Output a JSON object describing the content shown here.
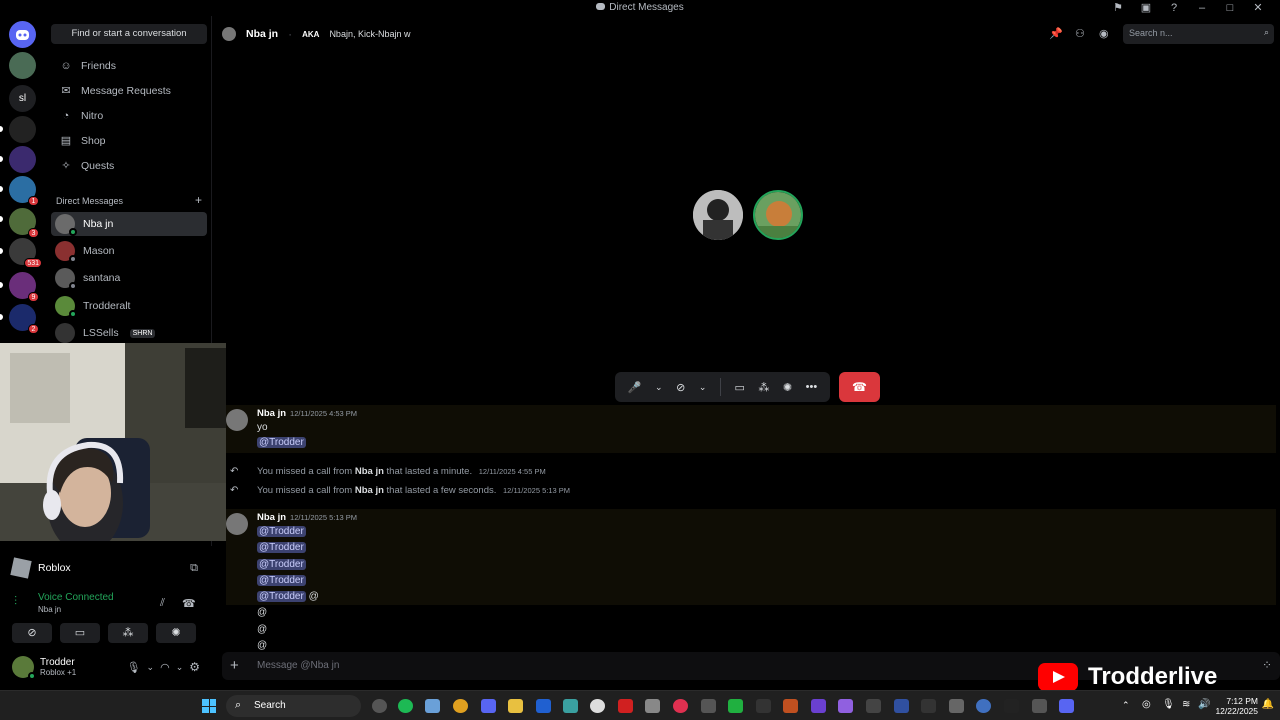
{
  "window": {
    "title": "Direct Messages"
  },
  "sidebar": {
    "find_label": "Find or start a conversation",
    "nav": [
      {
        "label": "Friends",
        "icon": "friends-icon"
      },
      {
        "label": "Message Requests",
        "icon": "mail-icon"
      },
      {
        "label": "Nitro",
        "icon": "nitro-icon"
      },
      {
        "label": "Shop",
        "icon": "shop-icon"
      },
      {
        "label": "Quests",
        "icon": "quests-icon"
      }
    ],
    "dm_header": "Direct Messages",
    "dm_add": "+",
    "dms": [
      {
        "name": "Nba jn",
        "active": true
      },
      {
        "name": "Mason"
      },
      {
        "name": "santana"
      },
      {
        "name": "Trodderalt"
      },
      {
        "name": "LSSells",
        "tag": "SHRN"
      }
    ]
  },
  "servers": {
    "badges": [
      "1",
      "3",
      "531",
      "9",
      "2"
    ],
    "text_icon": "sl"
  },
  "activity": {
    "label": "Roblox"
  },
  "voice": {
    "status": "Voice Connected",
    "channel": "Nba jn"
  },
  "user": {
    "name": "Trodder",
    "sub": "Roblox +1"
  },
  "header": {
    "name": "Nba jn",
    "aka_label": "AKA",
    "aliases": "Nbajn, Kick-Nbajn w",
    "search_placeholder": "Search n..."
  },
  "messages": {
    "first": {
      "author": "Nba jn",
      "time": "12/11/2025 4:53 PM",
      "text": "yo",
      "mention": "@Trodder"
    },
    "missed": [
      {
        "pre": "You missed a call from ",
        "who": "Nba jn",
        "post": " that lasted a minute.",
        "time": "12/11/2025 4:55 PM"
      },
      {
        "pre": "You missed a call from ",
        "who": "Nba jn",
        "post": " that lasted a few seconds.",
        "time": "12/11/2025 5:13 PM"
      }
    ],
    "second": {
      "author": "Nba jn",
      "time": "12/11/2025 5:13 PM",
      "mention": "@Trodder",
      "trailing": "@",
      "ats": [
        "@",
        "@",
        "@"
      ]
    }
  },
  "composer": {
    "placeholder": "Message @Nba jn",
    "plus": "+"
  },
  "overlay": {
    "brand": "Trodderlive"
  },
  "taskbar": {
    "search": "Search",
    "time": "7:12 PM",
    "date": "12/22/2025"
  },
  "colors": {
    "accent": "#5865f2",
    "danger": "#da373c",
    "online": "#23a55a",
    "mention_bg": "#3c4270"
  }
}
